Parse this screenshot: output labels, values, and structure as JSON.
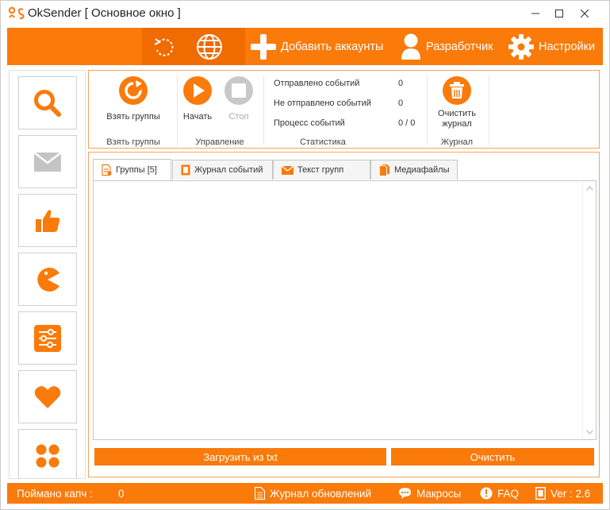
{
  "window": {
    "title": "OkSender [ Основное окно ]",
    "controls": {
      "minimize": "–",
      "maximize": "☐",
      "close": "✕"
    }
  },
  "colors": {
    "accent": "#fa7a0a",
    "accent_dark": "#f06b00",
    "border": "#f1a45e"
  },
  "toolbar": {
    "items": [
      {
        "icon": "refresh-icon",
        "label": ""
      },
      {
        "icon": "globe-icon",
        "label": ""
      },
      {
        "icon": "plus-icon",
        "label": "Добавить аккаунты"
      },
      {
        "icon": "user-icon",
        "label": "Разработчик"
      },
      {
        "icon": "gear-icon",
        "label": "Настройки"
      }
    ]
  },
  "sidebar": {
    "items": [
      {
        "icon": "search-icon"
      },
      {
        "icon": "envelope-icon"
      },
      {
        "icon": "thumbs-up-icon"
      },
      {
        "icon": "pacman-icon"
      },
      {
        "icon": "sliders-icon"
      },
      {
        "icon": "heart-icon"
      },
      {
        "icon": "grid-icon"
      }
    ]
  },
  "ribbon": {
    "groups": {
      "groups": {
        "label": "Взять группы",
        "button": "Взять группы"
      },
      "control": {
        "label": "Управление",
        "start": "Начать",
        "stop": "Стоп"
      },
      "stats": {
        "label": "Статистика",
        "rows": [
          {
            "name": "Отправлено событий",
            "value": "0"
          },
          {
            "name": "Не отправлено событий",
            "value": "0"
          },
          {
            "name": "Процесс событий",
            "value": "0 / 0"
          }
        ]
      },
      "log": {
        "label": "Журнал",
        "button": "Очистить журнал"
      }
    }
  },
  "tabs": [
    {
      "label": "Группы [5]",
      "icon": "document-icon",
      "active": true
    },
    {
      "label": "Журнал событий",
      "icon": "journal-icon",
      "active": false
    },
    {
      "label": "Текст групп",
      "icon": "envelope-icon",
      "active": false
    },
    {
      "label": "Медиафайлы",
      "icon": "files-icon",
      "active": false
    }
  ],
  "actions": {
    "load": "Загрузить из txt",
    "clear": "Очистить"
  },
  "statusbar": {
    "captcha_label": "Поймано капч :",
    "captcha_value": "0",
    "updates": "Журнал обновлений",
    "macros": "Макросы",
    "faq": "FAQ",
    "version": "Ver : 2.6"
  }
}
